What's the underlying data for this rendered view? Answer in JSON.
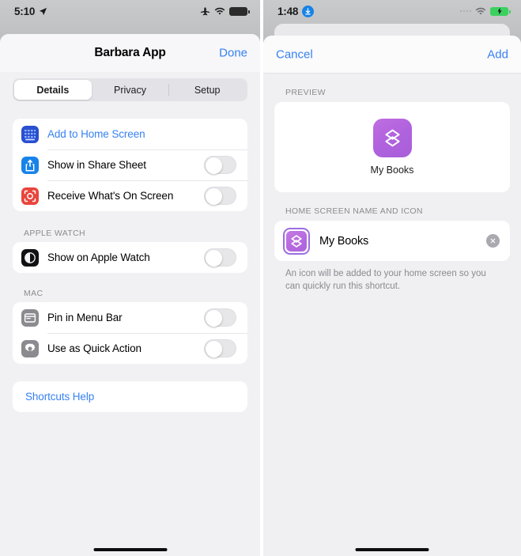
{
  "left": {
    "status_bar": {
      "time": "5:10",
      "location_icon": "location-arrow-icon",
      "airplane_icon": "airplane-mode-icon",
      "wifi_icon": "wifi-icon",
      "battery_icon": "battery-full-icon"
    },
    "navbar": {
      "title": "Barbara App",
      "done_label": "Done"
    },
    "tabs": [
      {
        "label": "Details",
        "active": true
      },
      {
        "label": "Privacy",
        "active": false
      },
      {
        "label": "Setup",
        "active": false
      }
    ],
    "group1": [
      {
        "label": "Add to Home Screen",
        "icon": "home-screen-grid-icon",
        "style": "link",
        "toggle": null
      },
      {
        "label": "Show in Share Sheet",
        "icon": "share-icon",
        "style": "plain",
        "toggle": "off"
      },
      {
        "label": "Receive What's On Screen",
        "icon": "screen-capture-icon",
        "style": "plain",
        "toggle": "off"
      }
    ],
    "watch_section_label": "APPLE WATCH",
    "group2": [
      {
        "label": "Show on Apple Watch",
        "icon": "apple-watch-icon",
        "style": "plain",
        "toggle": "off"
      }
    ],
    "mac_section_label": "MAC",
    "group3": [
      {
        "label": "Pin in Menu Bar",
        "icon": "menu-bar-icon",
        "style": "plain",
        "toggle": "off"
      },
      {
        "label": "Use as Quick Action",
        "icon": "gear-icon",
        "style": "plain",
        "toggle": "off"
      }
    ],
    "help_label": "Shortcuts Help"
  },
  "right": {
    "status_bar": {
      "time": "1:48",
      "download_icon": "download-badge-icon",
      "signal_icon": "signal-dots-icon",
      "wifi_icon": "wifi-icon",
      "battery_icon": "battery-charging-icon"
    },
    "navbar": {
      "cancel_label": "Cancel",
      "add_label": "Add"
    },
    "preview_label": "PREVIEW",
    "preview": {
      "app_name": "My Books",
      "icon": "shortcut-layers-icon"
    },
    "name_section_label": "HOME SCREEN NAME AND ICON",
    "name_field": {
      "value": "My Books",
      "icon": "shortcut-layers-icon",
      "clear_icon": "clear-circle-icon"
    },
    "helper_text": "An icon will be added to your home screen so you can quickly run this shortcut."
  },
  "colors": {
    "accent_blue": "#3781f2",
    "icon_purple": "#b062de",
    "battery_green": "#3ad15f",
    "grid_icon_blue": "#2a4fd0",
    "share_icon_blue": "#1783e8",
    "capture_icon_red": "#e8463d",
    "mac_icon_gray": "#8a8a8f"
  }
}
